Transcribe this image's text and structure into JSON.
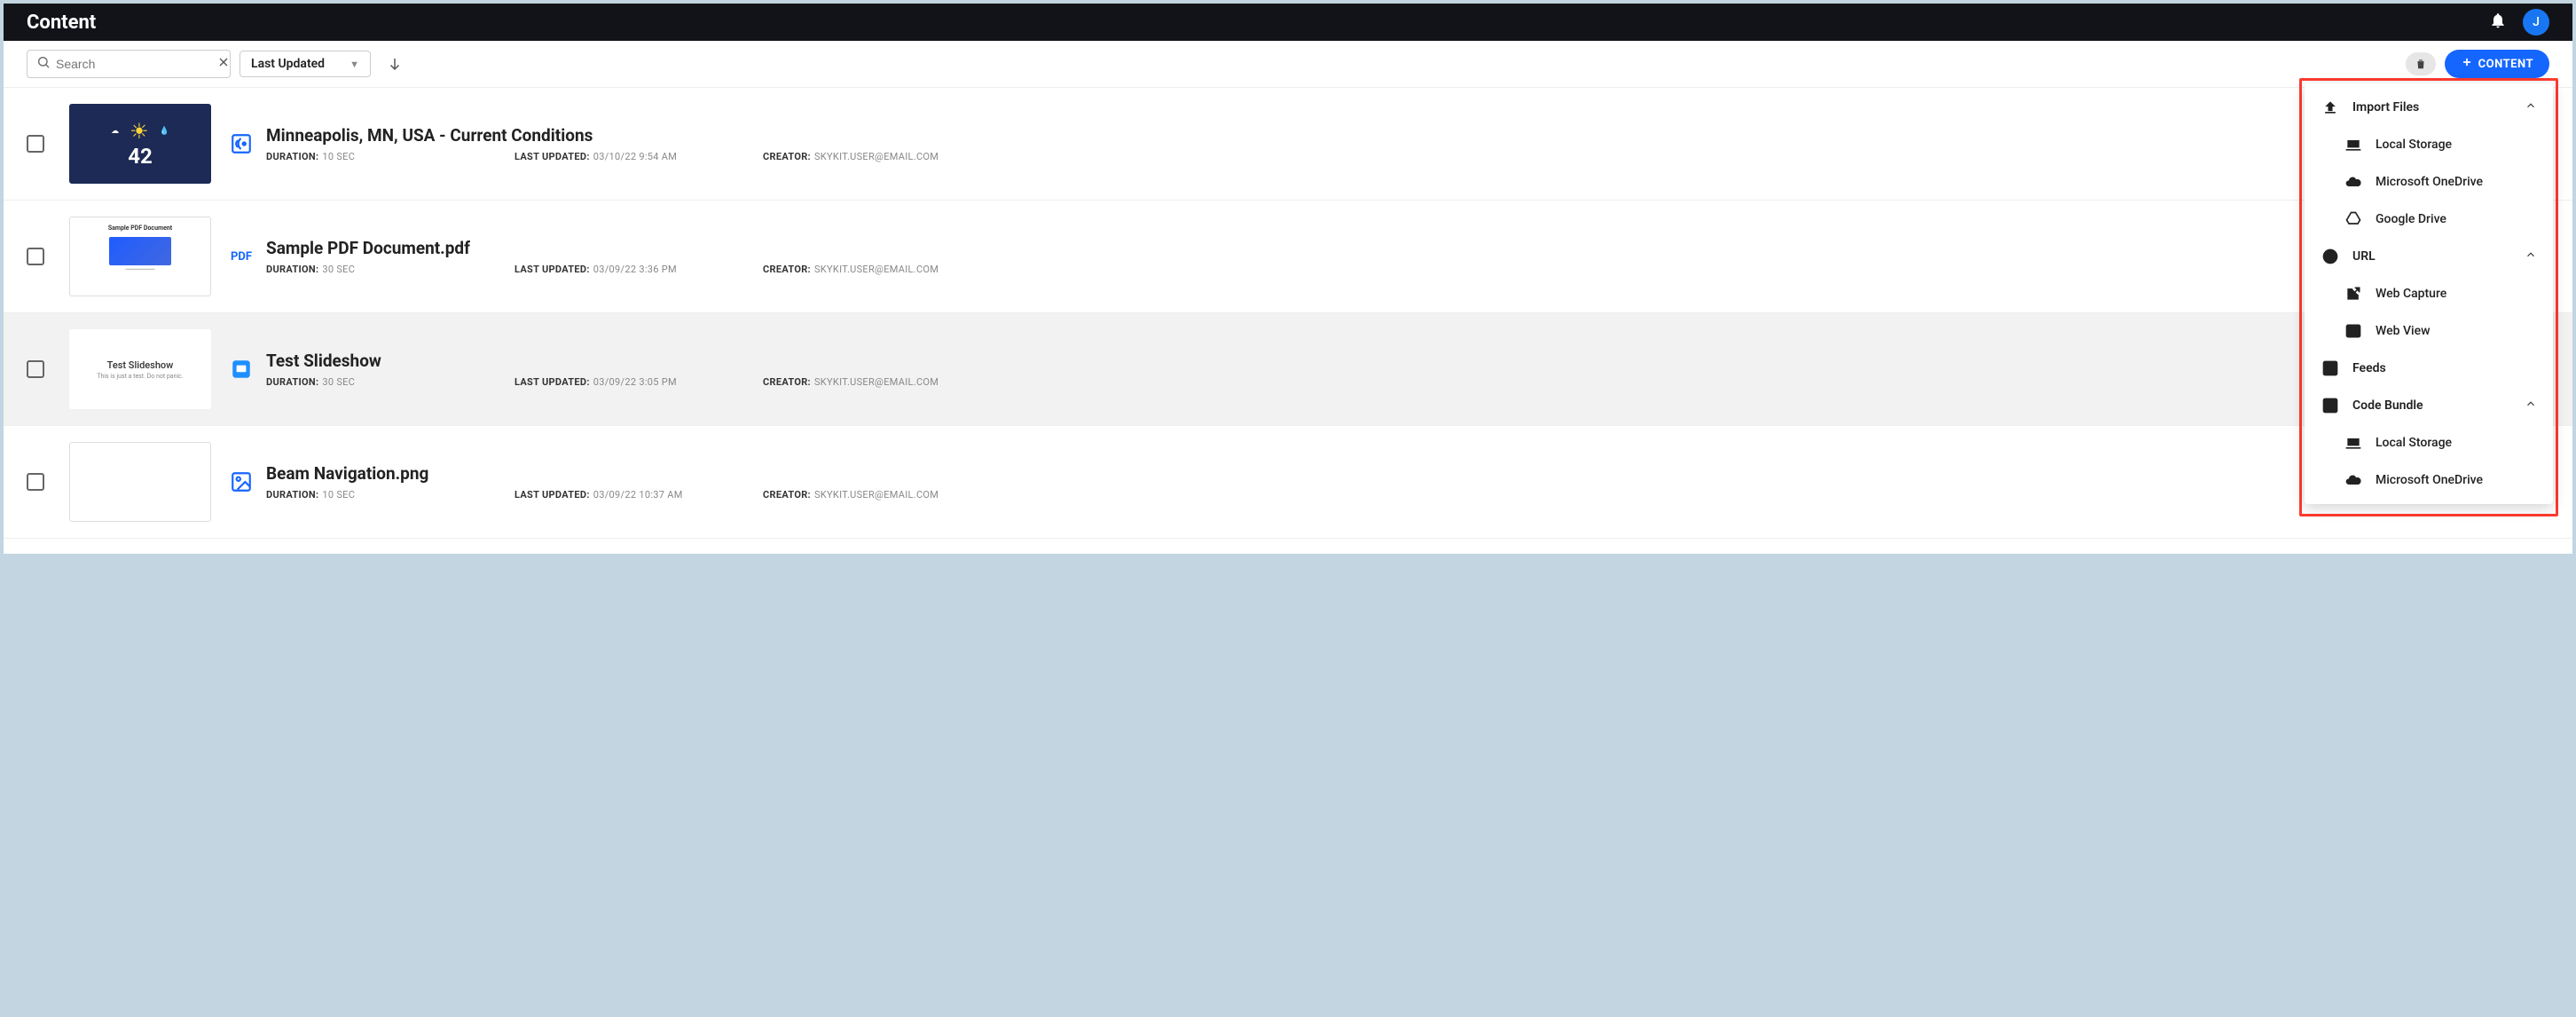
{
  "header": {
    "title": "Content",
    "avatar_initial": "J"
  },
  "toolbar": {
    "search_placeholder": "Search",
    "sort_label": "Last Updated",
    "content_btn": "CONTENT"
  },
  "rows": [
    {
      "title": "Minneapolis, MN, USA - Current Conditions",
      "duration_label": "DURATION:",
      "duration": "10 SEC",
      "updated_label": "LAST UPDATED:",
      "updated": "03/10/22 9:54 AM",
      "creator_label": "CREATOR:",
      "creator": "SKYKIT.USER@EMAIL.COM",
      "thumb_temp": "42"
    },
    {
      "title": "Sample PDF Document.pdf",
      "duration_label": "DURATION:",
      "duration": "30 SEC",
      "updated_label": "LAST UPDATED:",
      "updated": "03/09/22 3:36 PM",
      "creator_label": "CREATOR:",
      "creator": "SKYKIT.USER@EMAIL.COM",
      "badge_text": "PDF",
      "thumb_title": "Sample PDF Document"
    },
    {
      "title": "Test Slideshow",
      "duration_label": "DURATION:",
      "duration": "30 SEC",
      "updated_label": "LAST UPDATED:",
      "updated": "03/09/22 3:05 PM",
      "creator_label": "CREATOR:",
      "creator": "SKYKIT.USER@EMAIL.COM",
      "thumb_title": "Test Slideshow",
      "thumb_sub": "This is just a test. Do not panic."
    },
    {
      "title": "Beam Navigation.png",
      "duration_label": "DURATION:",
      "duration": "10 SEC",
      "updated_label": "LAST UPDATED:",
      "updated": "03/09/22 10:37 AM",
      "creator_label": "CREATOR:",
      "creator": "SKYKIT.USER@EMAIL.COM"
    }
  ],
  "popover": {
    "import_files": "Import Files",
    "local_storage": "Local Storage",
    "ms_onedrive": "Microsoft OneDrive",
    "google_drive": "Google Drive",
    "url": "URL",
    "web_capture": "Web Capture",
    "web_view": "Web View",
    "feeds": "Feeds",
    "code_bundle": "Code Bundle",
    "local_storage2": "Local Storage",
    "ms_onedrive2": "Microsoft OneDrive"
  }
}
